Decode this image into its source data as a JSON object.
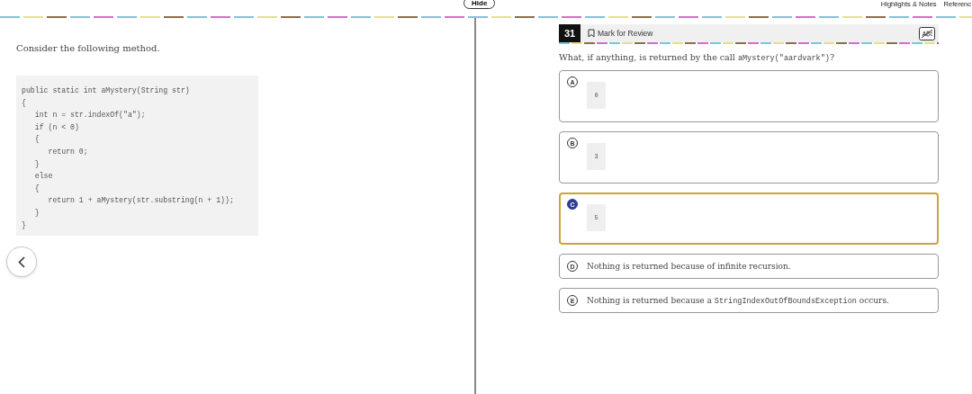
{
  "top_bar": {
    "hide_button": "Hide",
    "links": [
      "Highlights & Notes",
      "Referenc"
    ]
  },
  "left_pane": {
    "prompt": "Consider the following method.",
    "code_lines": [
      "public static int aMystery(String str)",
      "{",
      "   int n = str.indexOf(\"a\");",
      "   if (n < 0)",
      "   {",
      "      return 0;",
      "   }",
      "   else",
      "   {",
      "      return 1 + aMystery(str.substring(n + 1));",
      "   }",
      "}"
    ]
  },
  "question": {
    "number": "31",
    "mark_for_review": {
      "label": "Mark for Review",
      "checked": false
    },
    "prompt": [
      {
        "kind": "text",
        "text": "What, if anything, is returned by the call "
      },
      {
        "kind": "code",
        "text": "aMystery(\"aardvark\")"
      },
      {
        "kind": "text",
        "text": "?"
      }
    ],
    "options": [
      {
        "letter": "A",
        "kind": "code",
        "selected": false,
        "parts": [
          {
            "kind": "code",
            "text": "0"
          }
        ]
      },
      {
        "letter": "B",
        "kind": "code",
        "selected": false,
        "parts": [
          {
            "kind": "code",
            "text": "3"
          }
        ]
      },
      {
        "letter": "C",
        "kind": "code",
        "selected": true,
        "parts": [
          {
            "kind": "code",
            "text": "5"
          }
        ]
      },
      {
        "letter": "D",
        "kind": "text",
        "selected": false,
        "parts": [
          {
            "kind": "text",
            "text": "Nothing is returned because of infinite recursion."
          }
        ]
      },
      {
        "letter": "E",
        "kind": "text",
        "selected": false,
        "parts": [
          {
            "kind": "text",
            "text": "Nothing is returned because a "
          },
          {
            "kind": "code",
            "text": "StringIndexOutOfBoundsException"
          },
          {
            "kind": "text",
            "text": " occurs."
          }
        ]
      }
    ]
  }
}
